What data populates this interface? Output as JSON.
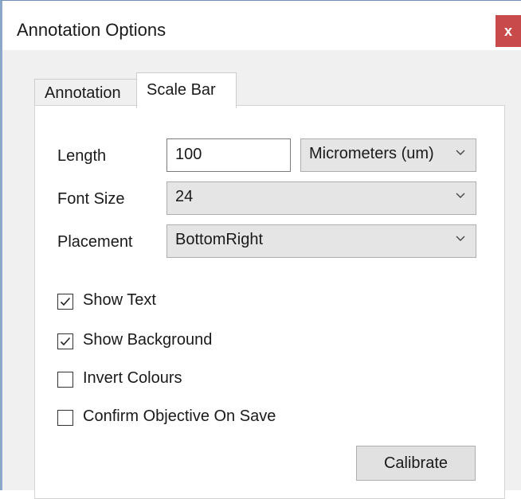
{
  "window": {
    "title": "Annotation Options",
    "close_glyph": "x"
  },
  "tabs": [
    {
      "label": "Annotation",
      "active": false
    },
    {
      "label": "Scale Bar",
      "active": true
    }
  ],
  "form": {
    "length": {
      "label": "Length",
      "value": "100",
      "unit": "Micrometers (um)"
    },
    "font_size": {
      "label": "Font Size",
      "value": "24"
    },
    "placement": {
      "label": "Placement",
      "value": "BottomRight"
    }
  },
  "checkboxes": [
    {
      "label": "Show Text",
      "checked": true
    },
    {
      "label": "Show Background",
      "checked": true
    },
    {
      "label": "Invert Colours",
      "checked": false
    },
    {
      "label": "Confirm Objective On Save",
      "checked": false
    }
  ],
  "buttons": {
    "calibrate": "Calibrate"
  },
  "icons": {
    "close": "close-icon",
    "dropdown": "chevron-down-icon",
    "check": "checkmark-icon"
  },
  "colors": {
    "close_button": "#c94a4a",
    "window_border": "#8aa6c8"
  }
}
